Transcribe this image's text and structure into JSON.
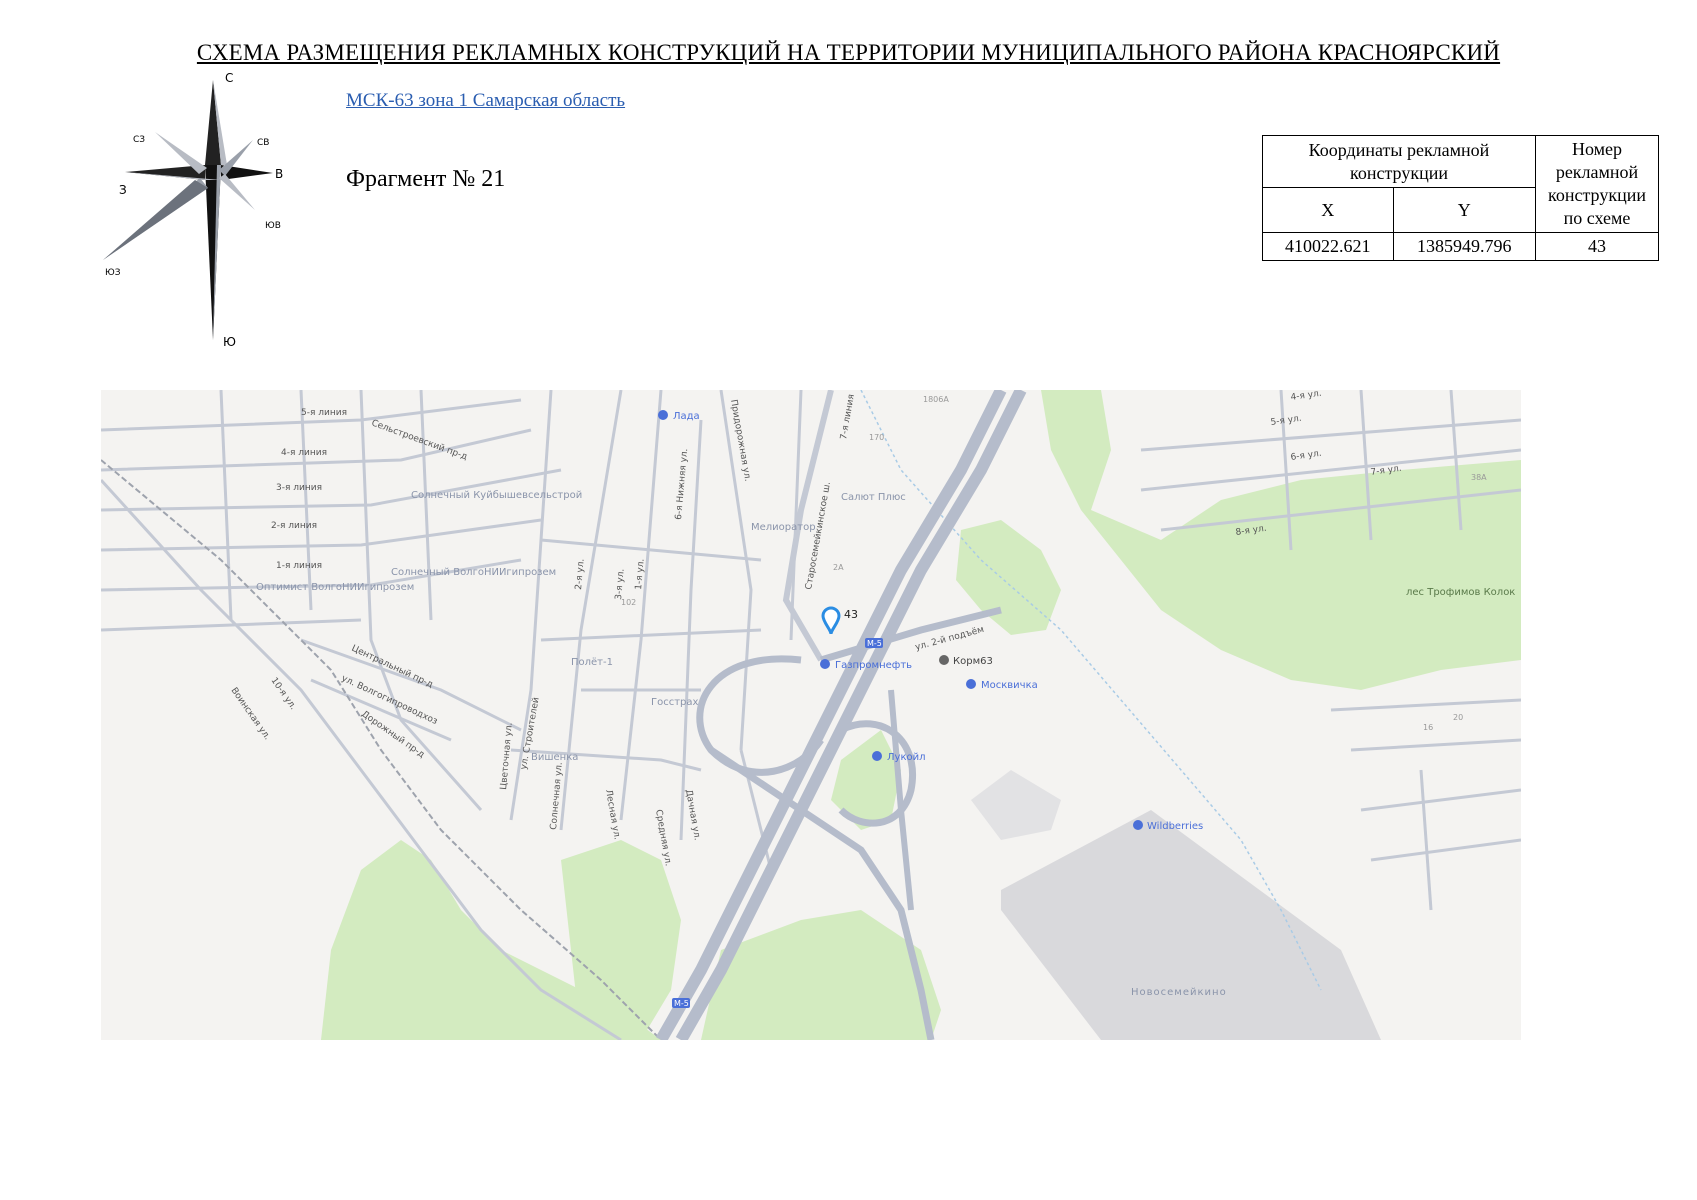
{
  "title": "СХЕМА РАЗМЕЩЕНИЯ РЕКЛАМНЫХ КОНСТРУКЦИЙ НА ТЕРРИТОРИИ МУНИЦИПАЛЬНОГО РАЙОНА КРАСНОЯРСКИЙ",
  "crs_link": "МСК-63 зона 1 Самарская область",
  "fragment": "Фрагмент № 21",
  "compass": {
    "n": "С",
    "s": "Ю",
    "e": "В",
    "w": "З",
    "ne": "СВ",
    "nw": "СЗ",
    "se": "ЮВ",
    "sw": "ЮЗ"
  },
  "table": {
    "header_coords": "Координаты рекламной конструкции",
    "header_number": "Номер рекламной конструкции по схеме",
    "col_x": "X",
    "col_y": "Y",
    "row": {
      "x": "410022.621",
      "y": "1385949.796",
      "number": "43"
    }
  },
  "colors": {
    "map_bg": "#f4f3f1",
    "forest": "#d3ebc0",
    "road": "#c4c9d4",
    "highway": "#b5bccb",
    "marker": "#2b8de3",
    "poi": "#4a6fd8"
  },
  "map": {
    "marker_label": "43",
    "streets": [
      "5-я линия",
      "4-я линия",
      "3-я линия",
      "2-я линия",
      "1-я линия",
      "Сельстроевский пр-д",
      "Центральный пр-д",
      "ул. Волгогипроводхоз",
      "Дорожный пр-д",
      "Воинская ул.",
      "10-я ул.",
      "Старосемейкинское ш.",
      "7-я линия",
      "Придорожная ул.",
      "6-я Нижняя ул.",
      "Цветочная ул.",
      "ул. Строителей",
      "Солнечная ул.",
      "Лесная ул.",
      "Средняя ул.",
      "Дачная ул.",
      "ул. 2-й подъём",
      "5-я ул.",
      "6-я ул.",
      "7-я ул.",
      "8-я ул.",
      "4-я ул.",
      "2-я ул.",
      "1-я ул.",
      "3-я ул."
    ],
    "areas": [
      "Солнечный Куйбышевсельстрой",
      "Солнечный ВолгоНИИгипрозем",
      "Оптимист ВолгоНИИгипрозем",
      "Мелиоратор",
      "Салют Плюс",
      "Полёт-1",
      "Госстрах",
      "Вишенка",
      "лес Трофимов Колок",
      "Новосемейкино"
    ],
    "pois": [
      "Лада",
      "Газпромнефть",
      "Корм63",
      "Москвичка",
      "Лукойл",
      "Wildberries"
    ],
    "road_shields": [
      "М-5"
    ],
    "house_numbers": [
      "1806А",
      "38А",
      "2А",
      "102",
      "170",
      "16",
      "20"
    ]
  }
}
